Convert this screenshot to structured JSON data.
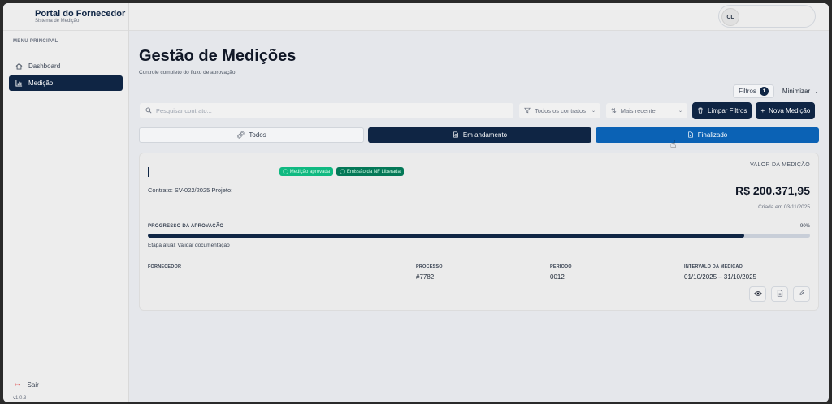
{
  "sidebar": {
    "brand_title": "Portal do Fornecedor",
    "brand_subtitle": "Sistema de Medição",
    "menu_label": "MENU PRINCIPAL",
    "items": [
      {
        "label": "Dashboard",
        "icon": "home-icon",
        "active": false
      },
      {
        "label": "Medição",
        "icon": "bar-chart-icon",
        "active": true
      }
    ],
    "logout_label": "Sair",
    "version": "v1.0.3"
  },
  "header": {
    "user_initials": "CL"
  },
  "page": {
    "title": "Gestão de Medições",
    "subtitle": "Controle completo do fluxo de aprovação"
  },
  "filters": {
    "filters_label": "Filtros",
    "filters_count": "1",
    "minimize_label": "Minimizar"
  },
  "toolbar": {
    "search_placeholder": "Pesquisar contrato...",
    "contracts_select": "Todos os contratos",
    "sort_select": "Mais recente",
    "clear_filters": "Limpar Filtros",
    "new_measurement": "Nova Medição"
  },
  "tabs": [
    {
      "label": "Todos",
      "icon": "link-icon"
    },
    {
      "label": "Em andamento",
      "icon": "file-clock-icon"
    },
    {
      "label": "Finalizado",
      "icon": "file-check-icon"
    }
  ],
  "card": {
    "badges": [
      {
        "label": "Medição aprovada",
        "color": "#10b981"
      },
      {
        "label": "Emissão da NF Liberada",
        "color": "#047857"
      }
    ],
    "value_label": "VALOR DA MEDIÇÃO",
    "contract_line": "Contrato: SV-022/2025 Projeto:",
    "amount": "R$ 200.371,95",
    "created": "Criada em 03/11/2025",
    "progress_label": "PROGRESSO DA APROVAÇÃO",
    "progress_pct_text": "90%",
    "progress_value": 90,
    "stage": "Etapa atual: Validar documentação",
    "meta": [
      {
        "label": "FORNECEDOR",
        "value": ""
      },
      {
        "label": "PROCESSO",
        "value": "#7782"
      },
      {
        "label": "PERÍODO",
        "value": "0012"
      },
      {
        "label": "INTERVALO DA MEDIÇÃO",
        "value": "01/10/2025 – 31/10/2025"
      }
    ]
  },
  "colors": {
    "primary": "#0f2544",
    "accent_blue": "#0b62b5",
    "success": "#10b981",
    "danger": "#dc2626"
  }
}
